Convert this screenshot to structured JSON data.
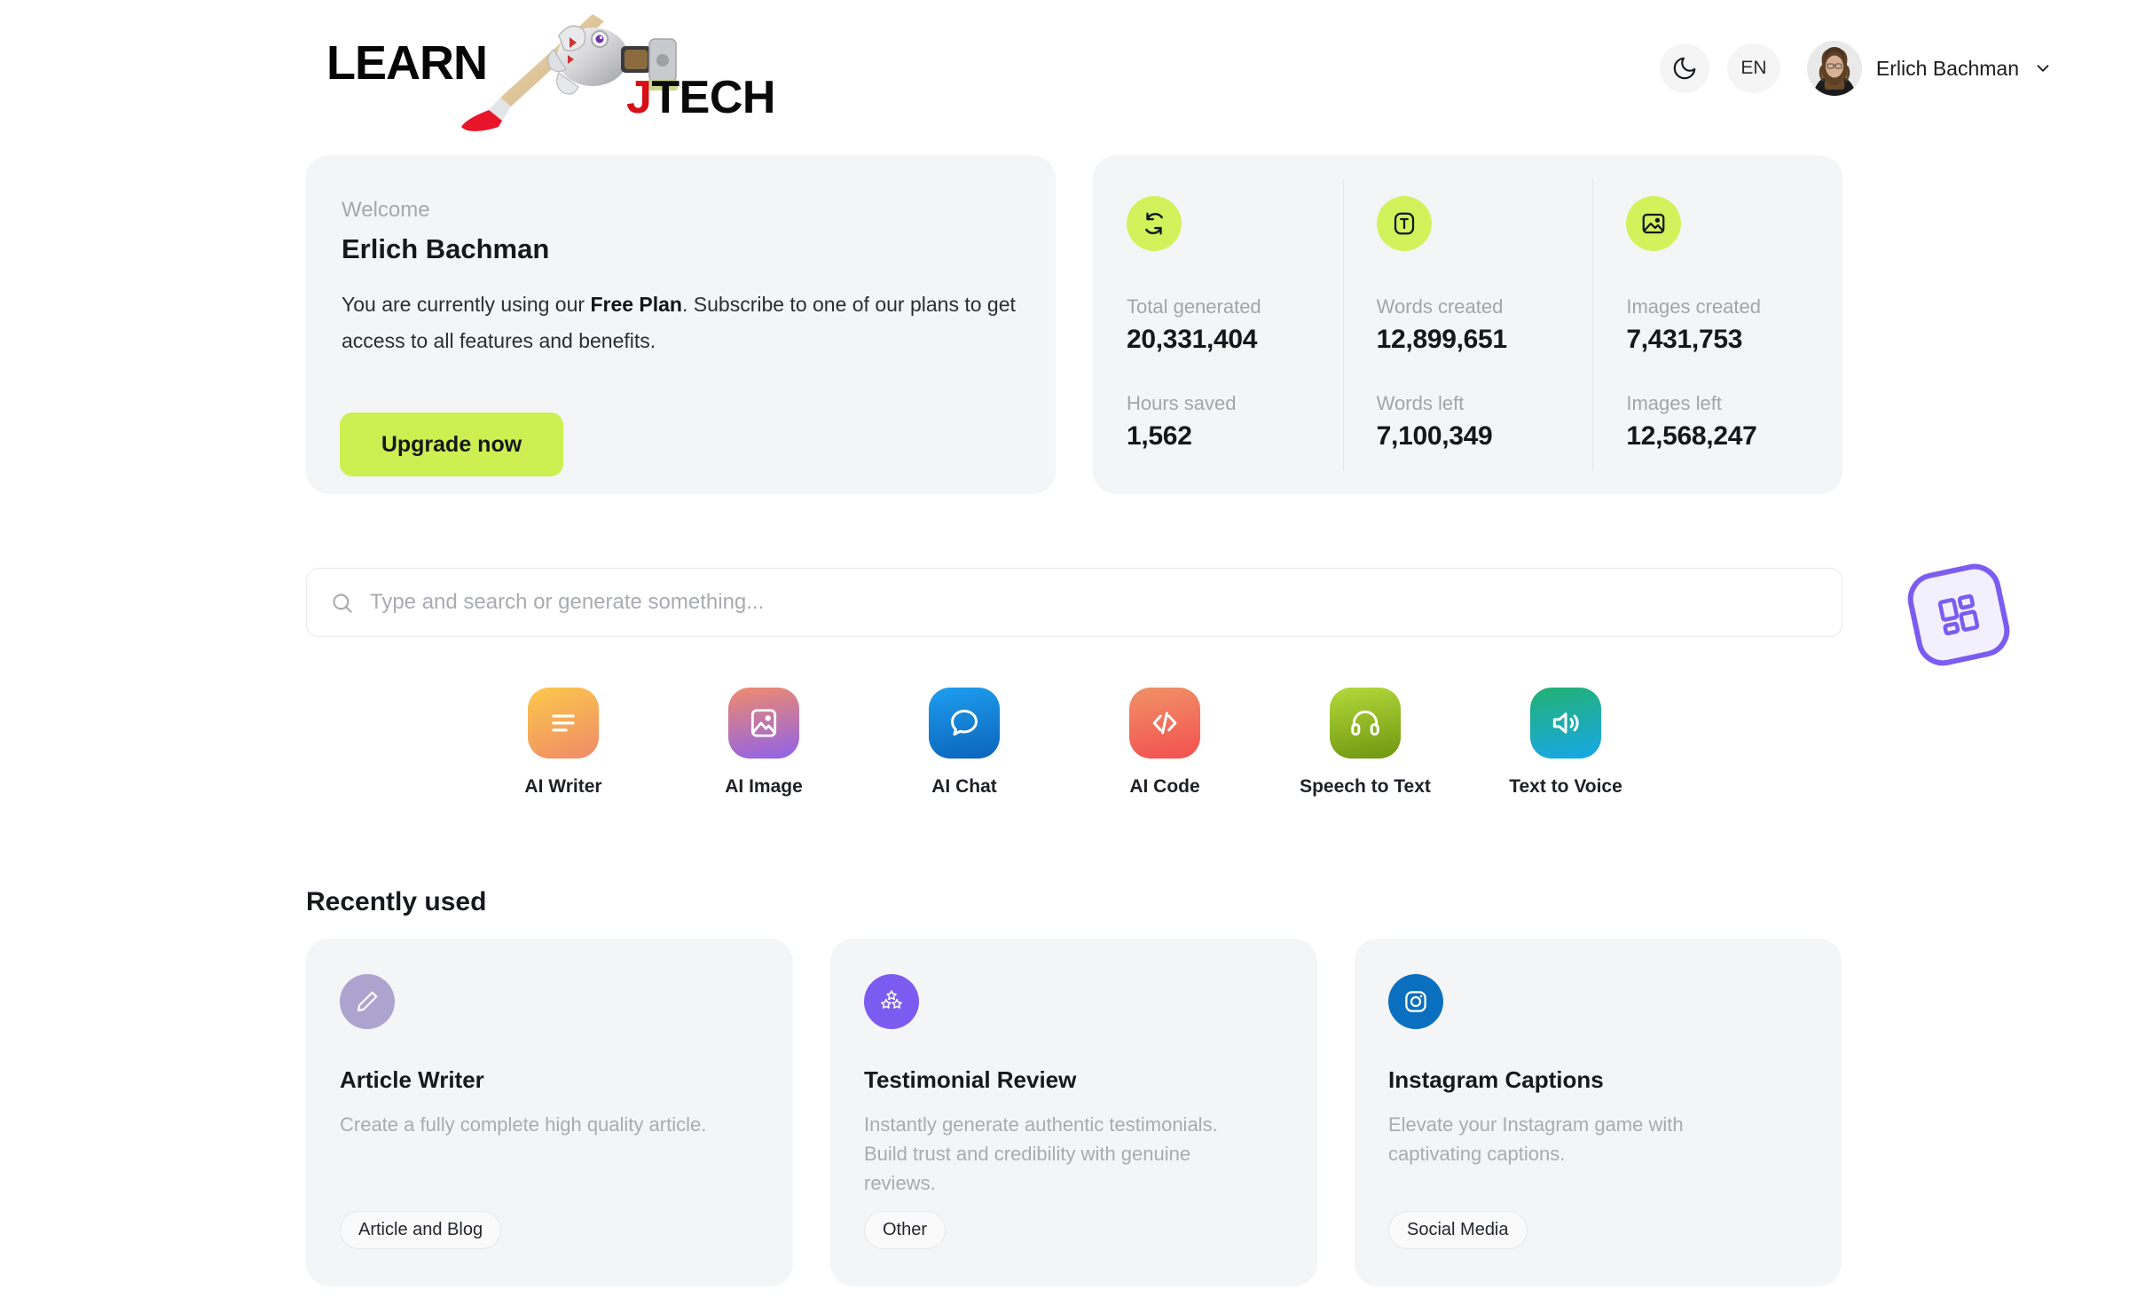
{
  "header": {
    "logo": {
      "left_text": "LEARN",
      "right_text": "TECH",
      "right_accent_letter": "J",
      "art": "robot-arm-paintbrush-image"
    },
    "theme_toggle_icon": "moon-icon",
    "language": "EN",
    "user_name": "Erlich Bachman",
    "chevron_icon": "chevron-down-icon"
  },
  "welcome": {
    "label": "Welcome",
    "name": "Erlich Bachman",
    "text_before": "You are currently using our ",
    "plan": "Free Plan",
    "text_after": ". Subscribe to one of our plans to get access to all features and benefits.",
    "upgrade_label": "Upgrade now",
    "upgrade_color": "#ccf052"
  },
  "stats": {
    "accent_color": "#d2f25c",
    "columns": [
      {
        "icon": "refresh-cycle-icon",
        "label": "Total generated",
        "value": "20,331,404",
        "label2": "Hours saved",
        "value2": "1,562"
      },
      {
        "icon": "text-box-icon",
        "label": "Words created",
        "value": "12,899,651",
        "label2": "Words left",
        "value2": "7,100,349"
      },
      {
        "icon": "image-icon",
        "label": "Images created",
        "value": "7,431,753",
        "label2": "Images left",
        "value2": "12,568,247"
      }
    ]
  },
  "search": {
    "icon": "search-icon",
    "placeholder": "Type and search or generate something...",
    "value": ""
  },
  "tools": [
    {
      "label": "AI Writer",
      "icon": "text-lines-icon",
      "color_from": "#fbc94a",
      "color_to": "#f08a6a"
    },
    {
      "label": "AI Image",
      "icon": "image-icon",
      "color_from": "#ef8b6c",
      "color_to": "#8f62ea"
    },
    {
      "label": "AI Chat",
      "icon": "chat-bubble-icon",
      "color_from": "#1e9ef0",
      "color_to": "#0b64ba"
    },
    {
      "label": "AI Code",
      "icon": "code-brackets-icon",
      "color_from": "#f09268",
      "color_to": "#f3504f"
    },
    {
      "label": "Speech to Text",
      "icon": "headphones-icon",
      "color_from": "#b3d93b",
      "color_to": "#6f9610"
    },
    {
      "label": "Text to Voice",
      "icon": "speaker-icon",
      "color_from": "#23b173",
      "color_to": "#17a7e8"
    }
  ],
  "recent": {
    "title": "Recently used",
    "cards": [
      {
        "icon": "pencil-icon",
        "icon_bg": "#aca3cf",
        "title": "Article Writer",
        "description": "Create a fully complete high quality article.",
        "tag": "Article and Blog"
      },
      {
        "icon": "three-stars-icon",
        "icon_bg": "#7c5cf0",
        "title": "Testimonial Review",
        "description": "Instantly generate authentic testimonials. Build trust and credibility with genuine reviews.",
        "tag": "Other"
      },
      {
        "icon": "instagram-icon",
        "icon_bg": "#0b6fc0",
        "title": "Instagram Captions",
        "description": "Elevate your Instagram game with captivating captions.",
        "tag": "Social Media"
      }
    ]
  },
  "floating_widget": {
    "icon": "grid-dashboard-icon",
    "color": "#7c5cf0"
  }
}
